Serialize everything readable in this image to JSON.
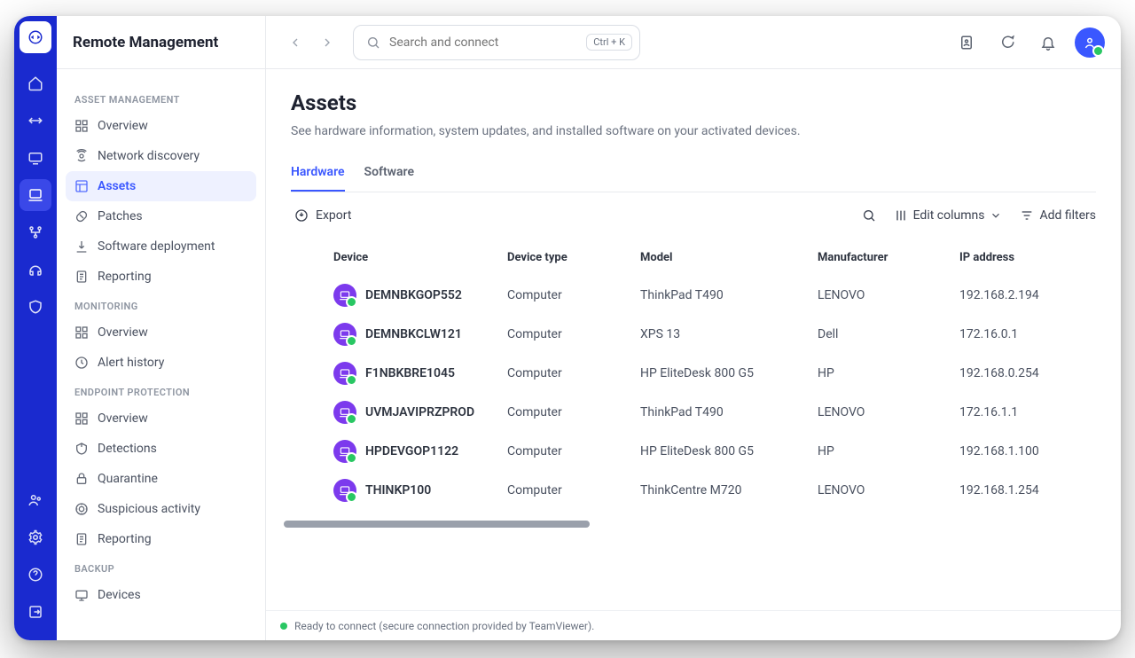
{
  "app_title": "Remote Management",
  "search": {
    "placeholder": "Search and connect",
    "shortcut": "Ctrl + K"
  },
  "sidebar": {
    "sections": [
      {
        "title": "ASSET MANAGEMENT",
        "items": [
          "Overview",
          "Network discovery",
          "Assets",
          "Patches",
          "Software deployment",
          "Reporting"
        ],
        "active_index": 2
      },
      {
        "title": "MONITORING",
        "items": [
          "Overview",
          "Alert history"
        ]
      },
      {
        "title": "ENDPOINT PROTECTION",
        "items": [
          "Overview",
          "Detections",
          "Quarantine",
          "Suspicious activity",
          "Reporting"
        ]
      },
      {
        "title": "BACKUP",
        "items": [
          "Devices"
        ]
      }
    ]
  },
  "page": {
    "title": "Assets",
    "subtitle": "See hardware information, system updates, and installed software on your activated devices.",
    "tabs": [
      "Hardware",
      "Software"
    ],
    "active_tab": 0,
    "export_label": "Export",
    "edit_columns_label": "Edit columns",
    "add_filters_label": "Add filters",
    "columns": [
      "Device",
      "Device type",
      "Model",
      "Manufacturer",
      "IP address"
    ],
    "rows": [
      {
        "device": "DEMNBKGOP552",
        "type": "Computer",
        "model": "ThinkPad T490",
        "manufacturer": "LENOVO",
        "ip": "192.168.2.194"
      },
      {
        "device": "DEMNBKCLW121",
        "type": "Computer",
        "model": "XPS 13",
        "manufacturer": "Dell",
        "ip": "172.16.0.1"
      },
      {
        "device": "F1NBKBRE1045",
        "type": "Computer",
        "model": "HP EliteDesk 800 G5",
        "manufacturer": "HP",
        "ip": "192.168.0.254"
      },
      {
        "device": "UVMJAVIPRZPROD",
        "type": "Computer",
        "model": "ThinkPad T490",
        "manufacturer": "LENOVO",
        "ip": "172.16.1.1"
      },
      {
        "device": "HPDEVGOP1122",
        "type": "Computer",
        "model": "HP EliteDesk 800 G5",
        "manufacturer": "HP",
        "ip": "192.168.1.100"
      },
      {
        "device": "THINKP100",
        "type": "Computer",
        "model": "ThinkCentre M720",
        "manufacturer": "LENOVO",
        "ip": "192.168.1.254"
      }
    ]
  },
  "status_text": "Ready to connect (secure connection provided by TeamViewer)."
}
